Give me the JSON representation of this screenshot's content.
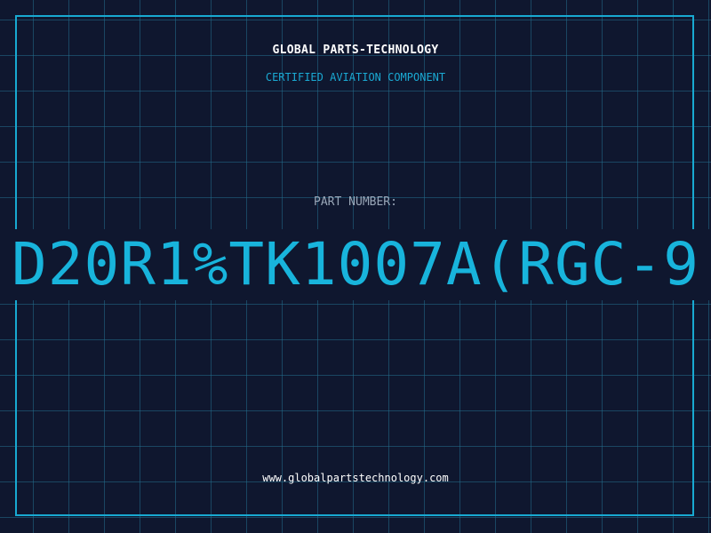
{
  "header": {
    "company": "GLOBAL PARTS-TECHNOLOGY",
    "subtitle": "CERTIFIED AVIATION COMPONENT"
  },
  "part": {
    "label": "PART NUMBER:",
    "value": "D20R1%TK1007A(RGC-9"
  },
  "footer": {
    "url": "www.globalpartstechnology.com"
  },
  "colors": {
    "background": "#0f172f",
    "accent": "#18b4dc",
    "frame": "#18a9d1",
    "label_gray": "#9aa7b8",
    "text_white": "#ffffff"
  }
}
